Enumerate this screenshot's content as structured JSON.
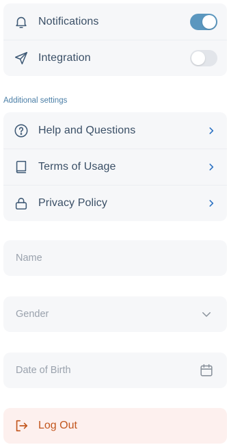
{
  "toggles_card": {
    "items": [
      {
        "label": "Notifications",
        "icon": "bell-icon",
        "enabled": true
      },
      {
        "label": "Integration",
        "icon": "send-icon",
        "enabled": false
      }
    ]
  },
  "additional": {
    "title": "Additional settings",
    "items": [
      {
        "label": "Help and Questions",
        "icon": "help-circle-icon"
      },
      {
        "label": "Terms of Usage",
        "icon": "book-icon"
      },
      {
        "label": "Privacy Policy",
        "icon": "lock-icon"
      }
    ]
  },
  "form": {
    "name_placeholder": "Name",
    "gender_placeholder": "Gender",
    "dob_placeholder": "Date of Birth"
  },
  "logout": {
    "label": "Log Out",
    "icon": "log-out-icon"
  },
  "colors": {
    "accent": "#5b97bf",
    "chevron": "#2f74c4",
    "text": "#3a4f66",
    "section_title": "#4a7ea6",
    "logout_text": "#c2561d",
    "logout_bg": "#fdf0ee",
    "card_bg": "#f6f7f9"
  }
}
